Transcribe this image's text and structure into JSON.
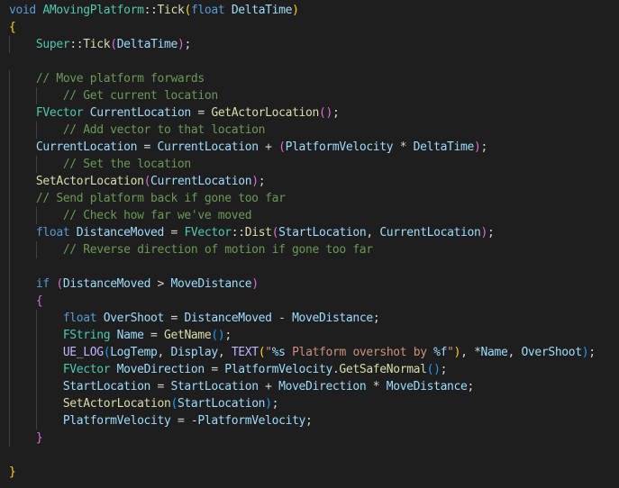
{
  "colors": {
    "background": "#1e1e1e",
    "keyword": "#569cd6",
    "type": "#4ec9b0",
    "function": "#dcdcaa",
    "variable": "#9cdcfe",
    "comment": "#6a9955",
    "string": "#ce9178",
    "default": "#d4d4d4",
    "bracket_level_1": "#ffd700",
    "bracket_level_2": "#da70d6",
    "bracket_level_3": "#179fff"
  },
  "code": {
    "lines": [
      {
        "indent": 0,
        "tokens": [
          [
            "kw",
            "void"
          ],
          [
            "op",
            " "
          ],
          [
            "ty",
            "AMovingPlatform"
          ],
          [
            "op",
            "::"
          ],
          [
            "fn",
            "Tick"
          ],
          [
            "b1",
            "("
          ],
          [
            "kw",
            "float"
          ],
          [
            "op",
            " "
          ],
          [
            "var",
            "DeltaTime"
          ],
          [
            "b1",
            ")"
          ]
        ]
      },
      {
        "indent": 0,
        "tokens": [
          [
            "b1",
            "{"
          ]
        ]
      },
      {
        "indent": 1,
        "tokens": [
          [
            "ty",
            "Super"
          ],
          [
            "op",
            "::"
          ],
          [
            "fn",
            "Tick"
          ],
          [
            "b2",
            "("
          ],
          [
            "var",
            "DeltaTime"
          ],
          [
            "b2",
            ")"
          ],
          [
            "op",
            ";"
          ]
        ]
      },
      {
        "indent": 0,
        "tokens": []
      },
      {
        "indent": 1,
        "tokens": [
          [
            "cm",
            "// Move platform forwards"
          ]
        ]
      },
      {
        "indent": 2,
        "tokens": [
          [
            "cm",
            "// Get current location"
          ]
        ]
      },
      {
        "indent": 1,
        "tokens": [
          [
            "ty",
            "FVector"
          ],
          [
            "op",
            " "
          ],
          [
            "var",
            "CurrentLocation"
          ],
          [
            "op",
            " = "
          ],
          [
            "fn",
            "GetActorLocation"
          ],
          [
            "b2",
            "()"
          ],
          [
            "op",
            ";"
          ]
        ]
      },
      {
        "indent": 2,
        "tokens": [
          [
            "cm",
            "// Add vector to that location"
          ]
        ]
      },
      {
        "indent": 1,
        "tokens": [
          [
            "var",
            "CurrentLocation"
          ],
          [
            "op",
            " = "
          ],
          [
            "var",
            "CurrentLocation"
          ],
          [
            "op",
            " + "
          ],
          [
            "b2",
            "("
          ],
          [
            "var",
            "PlatformVelocity"
          ],
          [
            "op",
            " * "
          ],
          [
            "var",
            "DeltaTime"
          ],
          [
            "b2",
            ")"
          ],
          [
            "op",
            ";"
          ]
        ]
      },
      {
        "indent": 2,
        "tokens": [
          [
            "cm",
            "// Set the location"
          ]
        ]
      },
      {
        "indent": 1,
        "tokens": [
          [
            "fn",
            "SetActorLocation"
          ],
          [
            "b2",
            "("
          ],
          [
            "var",
            "CurrentLocation"
          ],
          [
            "b2",
            ")"
          ],
          [
            "op",
            ";"
          ]
        ]
      },
      {
        "indent": 1,
        "tokens": [
          [
            "cm",
            "// Send platform back if gone too far"
          ]
        ]
      },
      {
        "indent": 2,
        "tokens": [
          [
            "cm",
            "// Check how far we've moved"
          ]
        ]
      },
      {
        "indent": 1,
        "tokens": [
          [
            "kw",
            "float"
          ],
          [
            "op",
            " "
          ],
          [
            "var",
            "DistanceMoved"
          ],
          [
            "op",
            " = "
          ],
          [
            "ty",
            "FVector"
          ],
          [
            "op",
            "::"
          ],
          [
            "fn",
            "Dist"
          ],
          [
            "b2",
            "("
          ],
          [
            "var",
            "StartLocation"
          ],
          [
            "op",
            ", "
          ],
          [
            "var",
            "CurrentLocation"
          ],
          [
            "b2",
            ")"
          ],
          [
            "op",
            ";"
          ]
        ]
      },
      {
        "indent": 2,
        "tokens": [
          [
            "cm",
            "// Reverse direction of motion if gone too far"
          ]
        ]
      },
      {
        "indent": 1,
        "tokens": []
      },
      {
        "indent": 1,
        "tokens": [
          [
            "kw",
            "if"
          ],
          [
            "op",
            " "
          ],
          [
            "b2",
            "("
          ],
          [
            "var",
            "DistanceMoved"
          ],
          [
            "op",
            " > "
          ],
          [
            "var",
            "MoveDistance"
          ],
          [
            "b2",
            ")"
          ]
        ]
      },
      {
        "indent": 1,
        "tokens": [
          [
            "b2",
            "{"
          ]
        ]
      },
      {
        "indent": 2,
        "tokens": [
          [
            "kw",
            "float"
          ],
          [
            "op",
            " "
          ],
          [
            "var",
            "OverShoot"
          ],
          [
            "op",
            " = "
          ],
          [
            "var",
            "DistanceMoved"
          ],
          [
            "op",
            " - "
          ],
          [
            "var",
            "MoveDistance"
          ],
          [
            "op",
            ";"
          ]
        ]
      },
      {
        "indent": 2,
        "tokens": [
          [
            "ty",
            "FString"
          ],
          [
            "op",
            " "
          ],
          [
            "var",
            "Name"
          ],
          [
            "op",
            " = "
          ],
          [
            "fn",
            "GetName"
          ],
          [
            "b3",
            "()"
          ],
          [
            "op",
            ";"
          ]
        ]
      },
      {
        "indent": 2,
        "tokens": [
          [
            "mac",
            "UE_LOG"
          ],
          [
            "b3",
            "("
          ],
          [
            "var",
            "LogTemp"
          ],
          [
            "op",
            ", "
          ],
          [
            "var",
            "Display"
          ],
          [
            "op",
            ", "
          ],
          [
            "mac",
            "TEXT"
          ],
          [
            "b1",
            "("
          ],
          [
            "str",
            "\""
          ],
          [
            "esc",
            "%s"
          ],
          [
            "str",
            " Platform overshot by "
          ],
          [
            "esc",
            "%f"
          ],
          [
            "str",
            "\""
          ],
          [
            "b1",
            ")"
          ],
          [
            "op",
            ", *"
          ],
          [
            "var",
            "Name"
          ],
          [
            "op",
            ", "
          ],
          [
            "var",
            "OverShoot"
          ],
          [
            "b3",
            ")"
          ],
          [
            "op",
            ";"
          ]
        ]
      },
      {
        "indent": 2,
        "tokens": [
          [
            "ty",
            "FVector"
          ],
          [
            "op",
            " "
          ],
          [
            "var",
            "MoveDirection"
          ],
          [
            "op",
            " = "
          ],
          [
            "var",
            "PlatformVelocity"
          ],
          [
            "op",
            "."
          ],
          [
            "fn",
            "GetSafeNormal"
          ],
          [
            "b3",
            "()"
          ],
          [
            "op",
            ";"
          ]
        ]
      },
      {
        "indent": 2,
        "tokens": [
          [
            "var",
            "StartLocation"
          ],
          [
            "op",
            " = "
          ],
          [
            "var",
            "StartLocation"
          ],
          [
            "op",
            " + "
          ],
          [
            "var",
            "MoveDirection"
          ],
          [
            "op",
            " * "
          ],
          [
            "var",
            "MoveDistance"
          ],
          [
            "op",
            ";"
          ]
        ]
      },
      {
        "indent": 2,
        "tokens": [
          [
            "fn",
            "SetActorLocation"
          ],
          [
            "b3",
            "("
          ],
          [
            "var",
            "StartLocation"
          ],
          [
            "b3",
            ")"
          ],
          [
            "op",
            ";"
          ]
        ]
      },
      {
        "indent": 2,
        "tokens": [
          [
            "var",
            "PlatformVelocity"
          ],
          [
            "op",
            " = -"
          ],
          [
            "var",
            "PlatformVelocity"
          ],
          [
            "op",
            ";"
          ]
        ]
      },
      {
        "indent": 1,
        "tokens": [
          [
            "b2",
            "}"
          ]
        ]
      },
      {
        "indent": 0,
        "tokens": []
      },
      {
        "indent": 0,
        "tokens": [
          [
            "b1",
            "}"
          ]
        ]
      }
    ]
  }
}
